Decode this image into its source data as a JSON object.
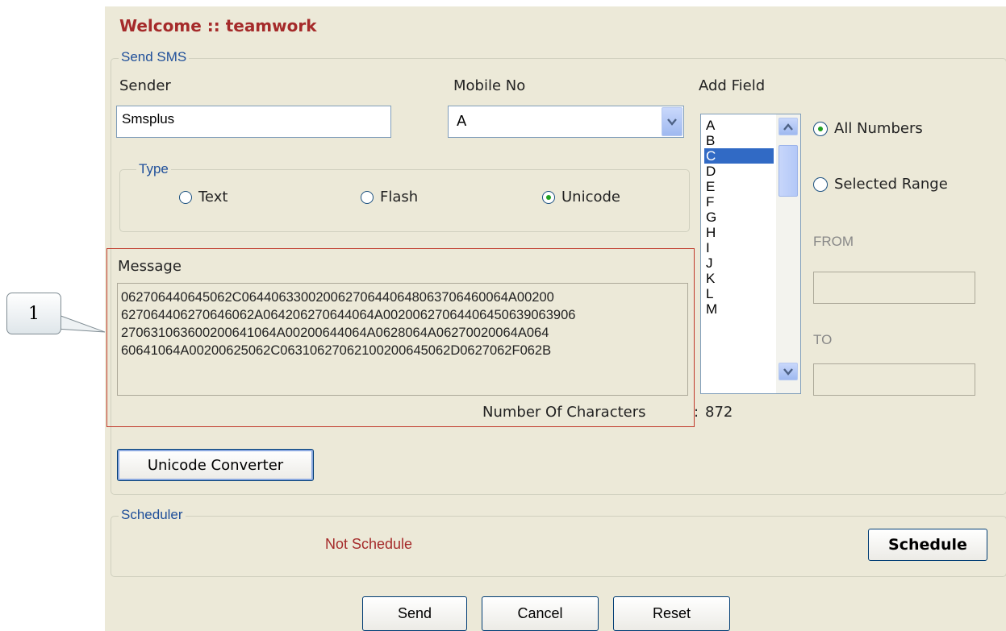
{
  "header": {
    "welcome": "Welcome :: teamwork"
  },
  "send_sms": {
    "legend": "Send SMS",
    "sender_label": "Sender",
    "sender_value": "Smsplus",
    "mobile_label": "Mobile No",
    "mobile_value": "A",
    "add_field_label": "Add Field",
    "type": {
      "legend": "Type",
      "options": [
        {
          "label": "Text",
          "selected": false
        },
        {
          "label": "Flash",
          "selected": false
        },
        {
          "label": "Unicode",
          "selected": true
        }
      ]
    },
    "field_list": {
      "items": [
        "A",
        "B",
        "C",
        "D",
        "E",
        "F",
        "G",
        "H",
        "I",
        "J",
        "K",
        "L",
        "M"
      ],
      "selected": "C"
    },
    "range": {
      "all_numbers": "All Numbers",
      "selected_range": "Selected Range",
      "from_label": "FROM",
      "to_label": "TO",
      "from_value": "",
      "to_value": ""
    },
    "message": {
      "label": "Message",
      "lines": [
        "062706440645062C064406330020062706440648063706460064A00200",
        "627064406270646062A064206270644064A00200627064406450639063906",
        "270631063600200641064A00200644064A0628064A06270020064A064",
        "60641064A00200625062C06310627062100200645062D0627062F062B"
      ],
      "char_count_label": "Number Of Characters",
      "char_count_sep": ":",
      "char_count": "872"
    },
    "unicode_converter": "Unicode Converter"
  },
  "scheduler": {
    "legend": "Scheduler",
    "status": "Not Schedule",
    "schedule_button": "Schedule"
  },
  "actions": {
    "send": "Send",
    "cancel": "Cancel",
    "reset": "Reset"
  },
  "annotation": {
    "callout_number": "1"
  },
  "colors": {
    "background": "#ece9d8",
    "welcome_text": "#a52a2a",
    "legend_text": "#1f4f9a",
    "selection": "#316ac5",
    "radio_dot": "#21a121",
    "highlight_frame": "#c0392b",
    "status_text": "#a52a2a"
  },
  "icons": {
    "dropdown": "chevron-down-icon",
    "scroll_up": "chevron-up-icon",
    "scroll_down": "chevron-down-icon"
  }
}
